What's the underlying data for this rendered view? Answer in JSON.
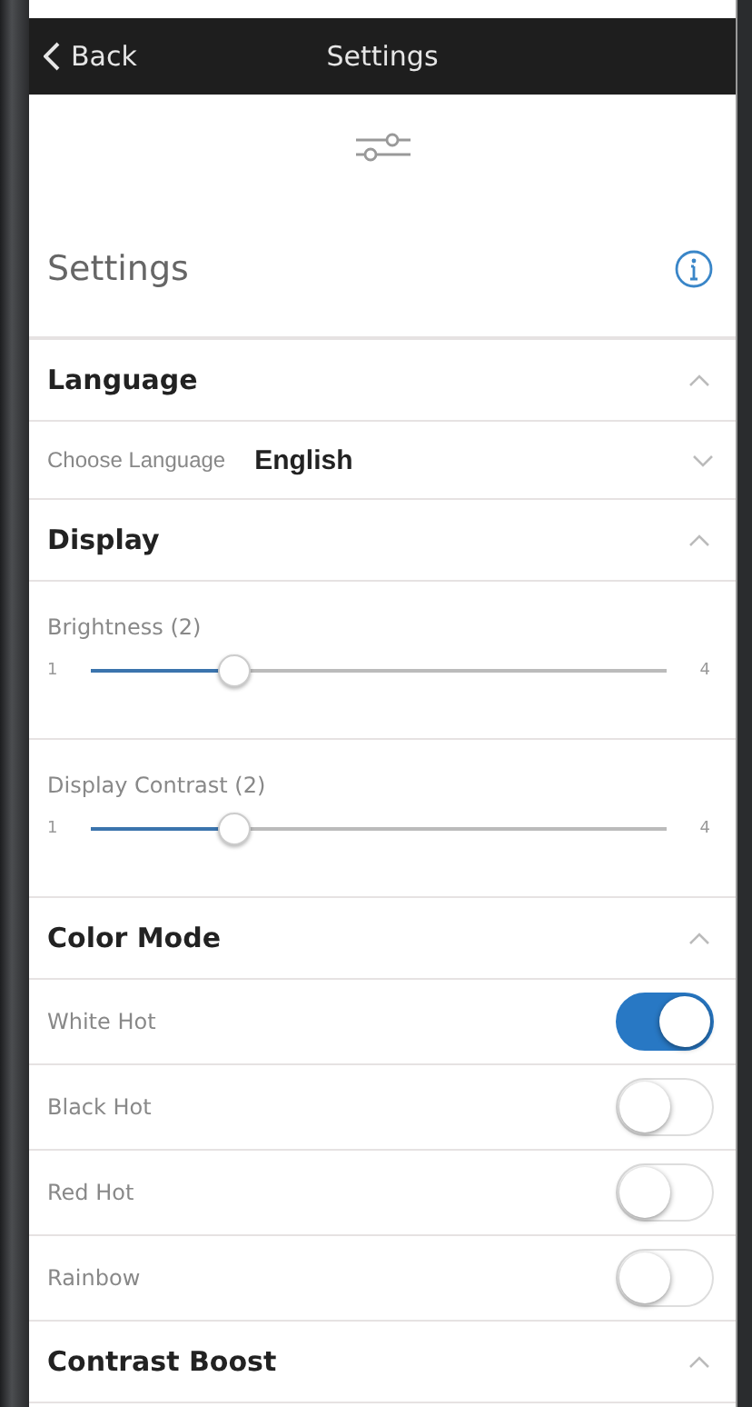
{
  "nav_bar": {
    "back": "Back",
    "title": "Settings"
  },
  "header": {
    "title": "Settings"
  },
  "sections": [
    {
      "title": "Language",
      "expanded": true,
      "rows": [
        {
          "kind": "select",
          "label": "Choose Language",
          "value": "English"
        }
      ]
    },
    {
      "title": "Display",
      "expanded": true,
      "rows": [
        {
          "kind": "slider",
          "label": "Brightness (2)",
          "min": "1",
          "max": "4",
          "level": 0.25
        },
        {
          "kind": "slider",
          "label": "Display Contrast (2)",
          "min": "1",
          "max": "4",
          "level": 0.25
        }
      ]
    },
    {
      "title": "Color Mode",
      "expanded": true,
      "rows": [
        {
          "kind": "toggle",
          "label": "White Hot",
          "on": true
        },
        {
          "kind": "toggle",
          "label": "Black Hot",
          "on": false
        },
        {
          "kind": "toggle",
          "label": "Red Hot",
          "on": false
        },
        {
          "kind": "toggle",
          "label": "Rainbow",
          "on": false
        }
      ]
    },
    {
      "title": "Contrast Boost",
      "expanded": true
    }
  ]
}
